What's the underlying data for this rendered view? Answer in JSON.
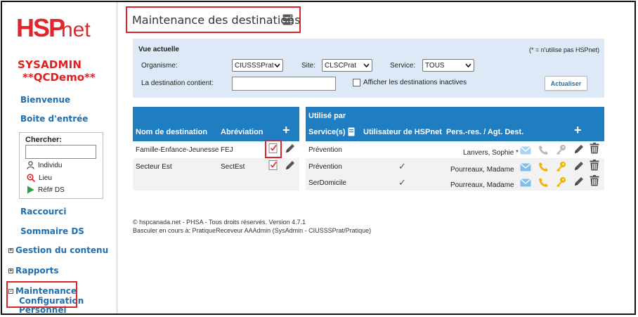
{
  "brand": {
    "logo_text_hsp": "HSP",
    "logo_text_net": "net",
    "red": "#e0262a",
    "blue": "#1f7ec1"
  },
  "user": {
    "name": "SYSADMIN",
    "environment": "**QCDemo**"
  },
  "sidebar": {
    "links": [
      {
        "label": "Bienvenue"
      },
      {
        "label": "Boite d'entrée"
      }
    ],
    "search": {
      "label": "Chercher:",
      "value": "",
      "options": [
        {
          "label": "Individu",
          "icon": "person-icon"
        },
        {
          "label": "Lieu",
          "icon": "location-search-icon"
        },
        {
          "label": "Réf# DS",
          "icon": "play-icon"
        }
      ]
    },
    "links_after": [
      {
        "label": "Raccourci"
      },
      {
        "label": "Sommaire DS"
      }
    ],
    "tree": [
      {
        "toggle": "+",
        "label": "Gestion du contenu"
      },
      {
        "toggle": "+",
        "label": "Rapports"
      },
      {
        "toggle": "-",
        "label": "Maintenance"
      }
    ],
    "tree_children": [
      {
        "label": "Configuration"
      },
      {
        "label": "Personnel"
      }
    ]
  },
  "page": {
    "title": "Maintenance des destinations",
    "title_icon": "server-icon"
  },
  "filters": {
    "heading": "Vue actuelle",
    "note": "(* = n'utilise pas HSPnet)",
    "organisme_label": "Organisme:",
    "organisme_value": "CIUSSSPrat",
    "site_label": "Site:",
    "site_value": "CLSCPrat",
    "service_label": "Service:",
    "service_value": "TOUS",
    "destination_label": "La destination contient:",
    "destination_value": "",
    "inactive_label": "Afficher les destinations inactives",
    "inactive_checked": false,
    "refresh_label": "Actualiser"
  },
  "destinations_table": {
    "col_name": "Nom de destination",
    "col_abbr": "Abréviation",
    "add_label": "+",
    "rows": [
      {
        "name": "Famille-Enfance-Jeunesse",
        "abbr": "FEJ"
      },
      {
        "name": "Secteur Est",
        "abbr": "SectEst"
      }
    ]
  },
  "usage_table": {
    "heading": "Utilisé par",
    "col_service": "Service(s)",
    "col_user": "Utilisateur de HSPnet",
    "col_contact": "Pers.-res. / Agt. Dest.",
    "add_label": "+",
    "rows": [
      {
        "service": "Prévention",
        "user_check": "",
        "contact": "Lanvers, Sophie *"
      },
      {
        "service": "Prévention",
        "user_check": "✓",
        "contact": "Pourreaux, Madame"
      },
      {
        "service": "SerDomicile",
        "user_check": "✓",
        "contact": "Pourreaux, Madame"
      }
    ]
  },
  "footer": {
    "line1": "© hspcanada.net - PHSA - Tous droits réservés.    Version 4.7.1",
    "line2": "Basculer en cours à: PratiqueReceveur AAAdmin (SysAdmin - CIUSSSPrat/Pratique)"
  }
}
